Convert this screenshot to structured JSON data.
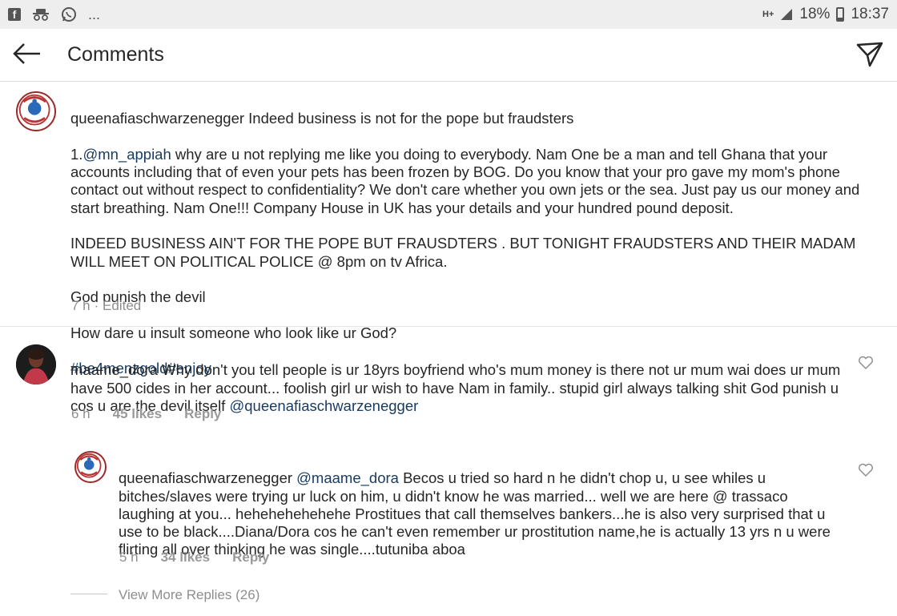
{
  "status_bar": {
    "left_icons": [
      "facebook-icon",
      "incognito-icon",
      "whatsapp-icon"
    ],
    "ellipsis": "...",
    "network": "H+",
    "battery": "18%",
    "time": "18:37"
  },
  "header": {
    "title": "Comments",
    "back_icon": "arrow-left-icon",
    "send_icon": "paper-plane-icon"
  },
  "comments": [
    {
      "username": "queenafiaschwarzenegger",
      "body_lines": [
        "Indeed business is not for the pope but fraudsters",
        "1.",
        "@mn_appiah",
        " why are u not replying me like you  doing to everybody. Nam One be a man and tell Ghana that your accounts including that of even your pets has been frozen by BOG. Do you know that your pro gave my mom's phone contact out without respect to confidentiality? We don't care whether you own jets or the sea. Just pay us our money and start breathing. Nam One!!! Company House in UK has your details and your hundred pound deposit.",
        "INDEED BUSINESS AIN'T FOR THE POPE BUT FRAUSDTERS . BUT TONIGHT FRAUDSTERS AND THEIR MADAM WILL MEET ON POLITICAL POLICE  @ 8pm on tv Africa.",
        "God punish the devil",
        "How dare u insult someone who look like ur God?",
        "#be4menzgold#enjoy"
      ],
      "time": "7 h",
      "edited": "· Edited",
      "avatar_text": "LEAVE2LIVE FOUNDATION"
    },
    {
      "username": "maame_dora",
      "body": "Why don't you tell people is ur 18yrs boyfriend who's mum money is there not ur mum wai does ur mum have 500 cides in her account... foolish girl ur wish to have Nam in family.. stupid girl always talking shit God punish u cos u are the devil itself ",
      "mention": "@queenafiaschwarzenegger",
      "time": "6 h",
      "likes": "45 likes",
      "reply": "Reply"
    },
    {
      "username": "queenafiaschwarzenegger",
      "mention": "@maame_dora",
      "body": " Becos u tried so hard n he didn't chop u, u see whiles u bitches/slaves were trying ur luck on him, u didn't know he was married... well we are here @ trassaco laughing at you... hehehehehehehe Prostitues that call themselves bankers...he is also very surprised that u use to be black....Diana/Dora cos he can't even remember  ur prostitution name,he is actually 13 yrs n u were flirting all over thinking he was single....tutuniba aboa",
      "time": "5 h",
      "likes": "34 likes",
      "reply": "Reply"
    }
  ],
  "view_more": "View More Replies (26)",
  "colors": {
    "mention": "#173a5e",
    "meta": "#8e8e8e",
    "text": "#262626"
  }
}
